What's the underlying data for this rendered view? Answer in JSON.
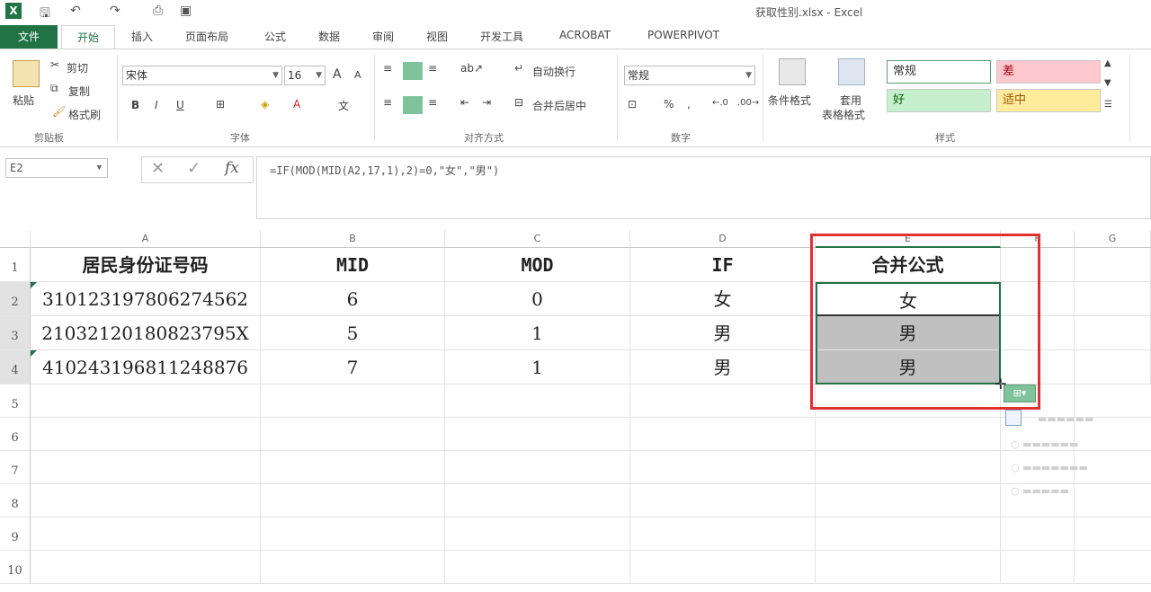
{
  "window": {
    "title": "获取性别.xlsx - Excel",
    "app_logo": "X"
  },
  "tabs": {
    "file": "文件",
    "active": "开始",
    "others": [
      "插入",
      "页面布局",
      "公式",
      "数据",
      "审阅",
      "视图",
      "开发工具",
      "ACROBAT",
      "POWERPIVOT"
    ]
  },
  "ribbon": {
    "clipboard": {
      "paste": "粘贴",
      "cut": "剪切",
      "copy": "复制",
      "painter": "格式刷",
      "label": "剪贴板"
    },
    "font": {
      "name": "宋体",
      "size": "16",
      "bold": "B",
      "italic": "I",
      "underline": "U",
      "grow": "A",
      "shrink": "A",
      "label": "字体"
    },
    "align": {
      "wrap": "自动换行",
      "merge": "合并后居中",
      "label": "对齐方式"
    },
    "number": {
      "format": "常规",
      "percent": "%",
      "comma": ",",
      "label": "数字"
    },
    "styles": {
      "conditional": "条件格式",
      "table_fmt_1": "套用",
      "table_fmt_2": "表格格式",
      "normal": "常规",
      "bad": "差",
      "good": "好",
      "neutral": "适中",
      "label": "样式"
    }
  },
  "formula_bar": {
    "name_box": "E2",
    "formula": "=IF(MOD(MID(A2,17,1),2)=0,\"女\",\"男\")",
    "fx": "fx",
    "cancel": "✕",
    "enter": "✓"
  },
  "sheet": {
    "columns": [
      "A",
      "B",
      "C",
      "D",
      "E",
      "F",
      "G"
    ],
    "rows": [
      "1",
      "2",
      "3",
      "4",
      "5",
      "6",
      "7",
      "8",
      "9",
      "10"
    ],
    "header": [
      "居民身份证号码",
      "MID",
      "MOD",
      "IF",
      "合并公式"
    ],
    "data": [
      [
        "310123197806274562",
        "6",
        "0",
        "女",
        "女"
      ],
      [
        "21032120180823795X",
        "5",
        "1",
        "男",
        "男"
      ],
      [
        "410243196811248876",
        "7",
        "1",
        "男",
        "男"
      ]
    ]
  },
  "colors": {
    "excel_green": "#217346",
    "highlight_red": "#e03030",
    "good_bg": "#c6efce",
    "bad_bg": "#ffc7ce",
    "neutral_bg": "#ffeb9c"
  }
}
